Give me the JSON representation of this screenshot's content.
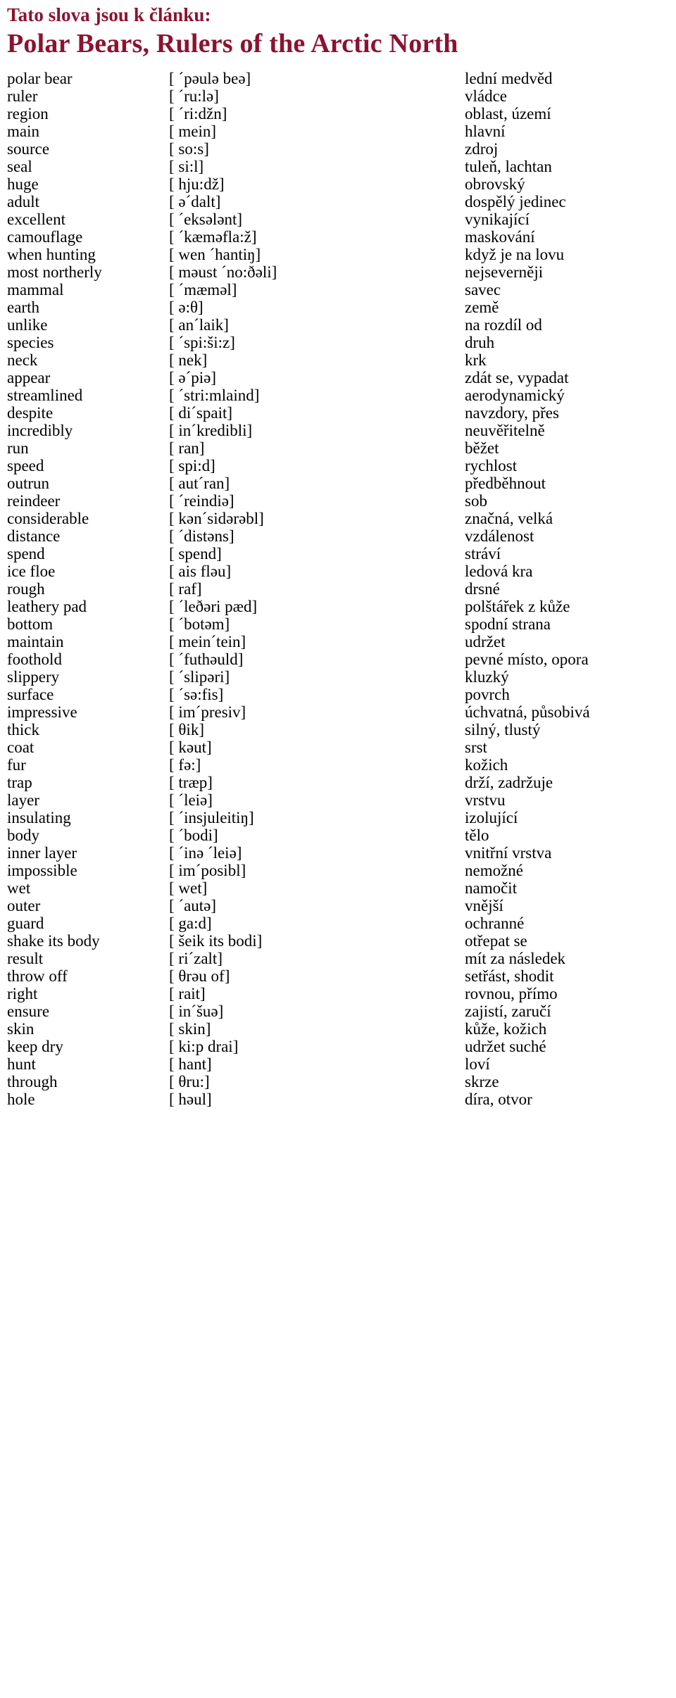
{
  "header": {
    "intro": "Tato slova jsou k článku:",
    "title": "Polar Bears, Rulers of the Arctic North",
    "accent_color": "#8c1230"
  },
  "vocabulary": [
    {
      "word": "polar bear",
      "phonetic": "[ ˊpəulə beə]",
      "translation": "lední medvěd"
    },
    {
      "word": "ruler",
      "phonetic": "[ ˊru:lə]",
      "translation": "vládce"
    },
    {
      "word": "region",
      "phonetic": "[ ˊri:džn]",
      "translation": "oblast, území"
    },
    {
      "word": "main",
      "phonetic": "[ mein]",
      "translation": "hlavní"
    },
    {
      "word": "source",
      "phonetic": "[ so:s]",
      "translation": "zdroj"
    },
    {
      "word": "seal",
      "phonetic": "[ si:l]",
      "translation": "tuleň, lachtan"
    },
    {
      "word": "huge",
      "phonetic": "[ hju:dž]",
      "translation": "obrovský"
    },
    {
      "word": "adult",
      "phonetic": "[ əˊdalt]",
      "translation": "dospělý jedinec"
    },
    {
      "word": "excellent",
      "phonetic": "[ ˊeksələnt]",
      "translation": "vynikající"
    },
    {
      "word": "camouflage",
      "phonetic": "[ ˊkæməfla:ž]",
      "translation": "maskování"
    },
    {
      "word": "when hunting",
      "phonetic": "[ wen ˊhantiŋ]",
      "translation": "když je na lovu"
    },
    {
      "word": "most northerly",
      "phonetic": "[ məust ˊno:ðəli]",
      "translation": "nejseverněji"
    },
    {
      "word": "mammal",
      "phonetic": "[ ˊmæməl]",
      "translation": "savec"
    },
    {
      "word": "earth",
      "phonetic": "[ ə:θ]",
      "translation": "země"
    },
    {
      "word": "unlike",
      "phonetic": "[ anˊlaik]",
      "translation": "na rozdíl od"
    },
    {
      "word": "species",
      "phonetic": "[ ˊspi:ši:z]",
      "translation": "druh"
    },
    {
      "word": "neck",
      "phonetic": "[ nek]",
      "translation": "krk"
    },
    {
      "word": "appear",
      "phonetic": "[ əˊpiə]",
      "translation": "zdát se, vypadat"
    },
    {
      "word": "streamlined",
      "phonetic": "[ ˊstri:mlaind]",
      "translation": "aerodynamický"
    },
    {
      "word": "despite",
      "phonetic": "[ diˊspait]",
      "translation": "navzdory, přes"
    },
    {
      "word": "incredibly",
      "phonetic": "[ inˊkredibli]",
      "translation": "neuvěřitelně"
    },
    {
      "word": "run",
      "phonetic": "[ ran]",
      "translation": "běžet"
    },
    {
      "word": "speed",
      "phonetic": "[ spi:d]",
      "translation": "rychlost"
    },
    {
      "word": "outrun",
      "phonetic": "[ autˊran]",
      "translation": "předběhnout"
    },
    {
      "word": "reindeer",
      "phonetic": "[ ˊreindiə]",
      "translation": "sob"
    },
    {
      "word": "considerable",
      "phonetic": "[ kənˊsidərəbl]",
      "translation": "značná, velká"
    },
    {
      "word": "distance",
      "phonetic": "[ ˊdistəns]",
      "translation": "vzdálenost"
    },
    {
      "word": "spend",
      "phonetic": "[ spend]",
      "translation": "stráví"
    },
    {
      "word": "ice floe",
      "phonetic": "[ ais fləu]",
      "translation": "ledová kra"
    },
    {
      "word": "rough",
      "phonetic": "[ raf]",
      "translation": "drsné"
    },
    {
      "word": "leathery pad",
      "phonetic": "[ ˊleðəri pæd]",
      "translation": "polštářek z kůže"
    },
    {
      "word": "bottom",
      "phonetic": "[ ˊbotəm]",
      "translation": "spodní strana"
    },
    {
      "word": "maintain",
      "phonetic": "[ meinˊtein]",
      "translation": "udržet"
    },
    {
      "word": "foothold",
      "phonetic": "[ ˊfuthəuld]",
      "translation": "pevné místo, opora"
    },
    {
      "word": "slippery",
      "phonetic": "[ ˊslipəri]",
      "translation": "kluzký"
    },
    {
      "word": "surface",
      "phonetic": "[ ˊsə:fis]",
      "translation": "povrch"
    },
    {
      "word": "impressive",
      "phonetic": "[ imˊpresiv]",
      "translation": "úchvatná, působivá"
    },
    {
      "word": "thick",
      "phonetic": "[ θik]",
      "translation": "silný, tlustý"
    },
    {
      "word": "coat",
      "phonetic": "[ kəut]",
      "translation": "srst"
    },
    {
      "word": "fur",
      "phonetic": "[ fə:]",
      "translation": "kožich"
    },
    {
      "word": "trap",
      "phonetic": "[ træp]",
      "translation": "drží, zadržuje"
    },
    {
      "word": "layer",
      "phonetic": "[ ˊleiə]",
      "translation": "vrstvu"
    },
    {
      "word": "insulating",
      "phonetic": "[ ˊinsjuleitiŋ]",
      "translation": "izolující"
    },
    {
      "word": "body",
      "phonetic": "[ ˊbodi]",
      "translation": "tělo"
    },
    {
      "word": "inner layer",
      "phonetic": "[ ˊinə ˊleiə]",
      "translation": "vnitřní vrstva"
    },
    {
      "word": "impossible",
      "phonetic": "[ imˊposibl]",
      "translation": "nemožné"
    },
    {
      "word": "wet",
      "phonetic": "[ wet]",
      "translation": "namočit"
    },
    {
      "word": "outer",
      "phonetic": "[ ˊautə]",
      "translation": "vnější"
    },
    {
      "word": "guard",
      "phonetic": "[ ga:d]",
      "translation": "ochranné"
    },
    {
      "word": "shake its body",
      "phonetic": "[ šeik its bodi]",
      "translation": "otřepat se"
    },
    {
      "word": "result",
      "phonetic": "[ riˊzalt]",
      "translation": "mít za následek"
    },
    {
      "word": "throw off",
      "phonetic": "[ θrəu of]",
      "translation": "setřást, shodit"
    },
    {
      "word": "right",
      "phonetic": "[ rait]",
      "translation": "rovnou, přímo"
    },
    {
      "word": "ensure",
      "phonetic": "[ inˊšuə]",
      "translation": "zajistí, zaručí"
    },
    {
      "word": "skin",
      "phonetic": "[ skin]",
      "translation": "kůže, kožich"
    },
    {
      "word": "keep dry",
      "phonetic": "[ ki:p drai]",
      "translation": "udržet suché"
    },
    {
      "word": "hunt",
      "phonetic": "[ hant]",
      "translation": "loví"
    },
    {
      "word": "through",
      "phonetic": "[ θru:]",
      "translation": "skrze"
    },
    {
      "word": "hole",
      "phonetic": "[ həul]",
      "translation": "díra, otvor"
    }
  ]
}
